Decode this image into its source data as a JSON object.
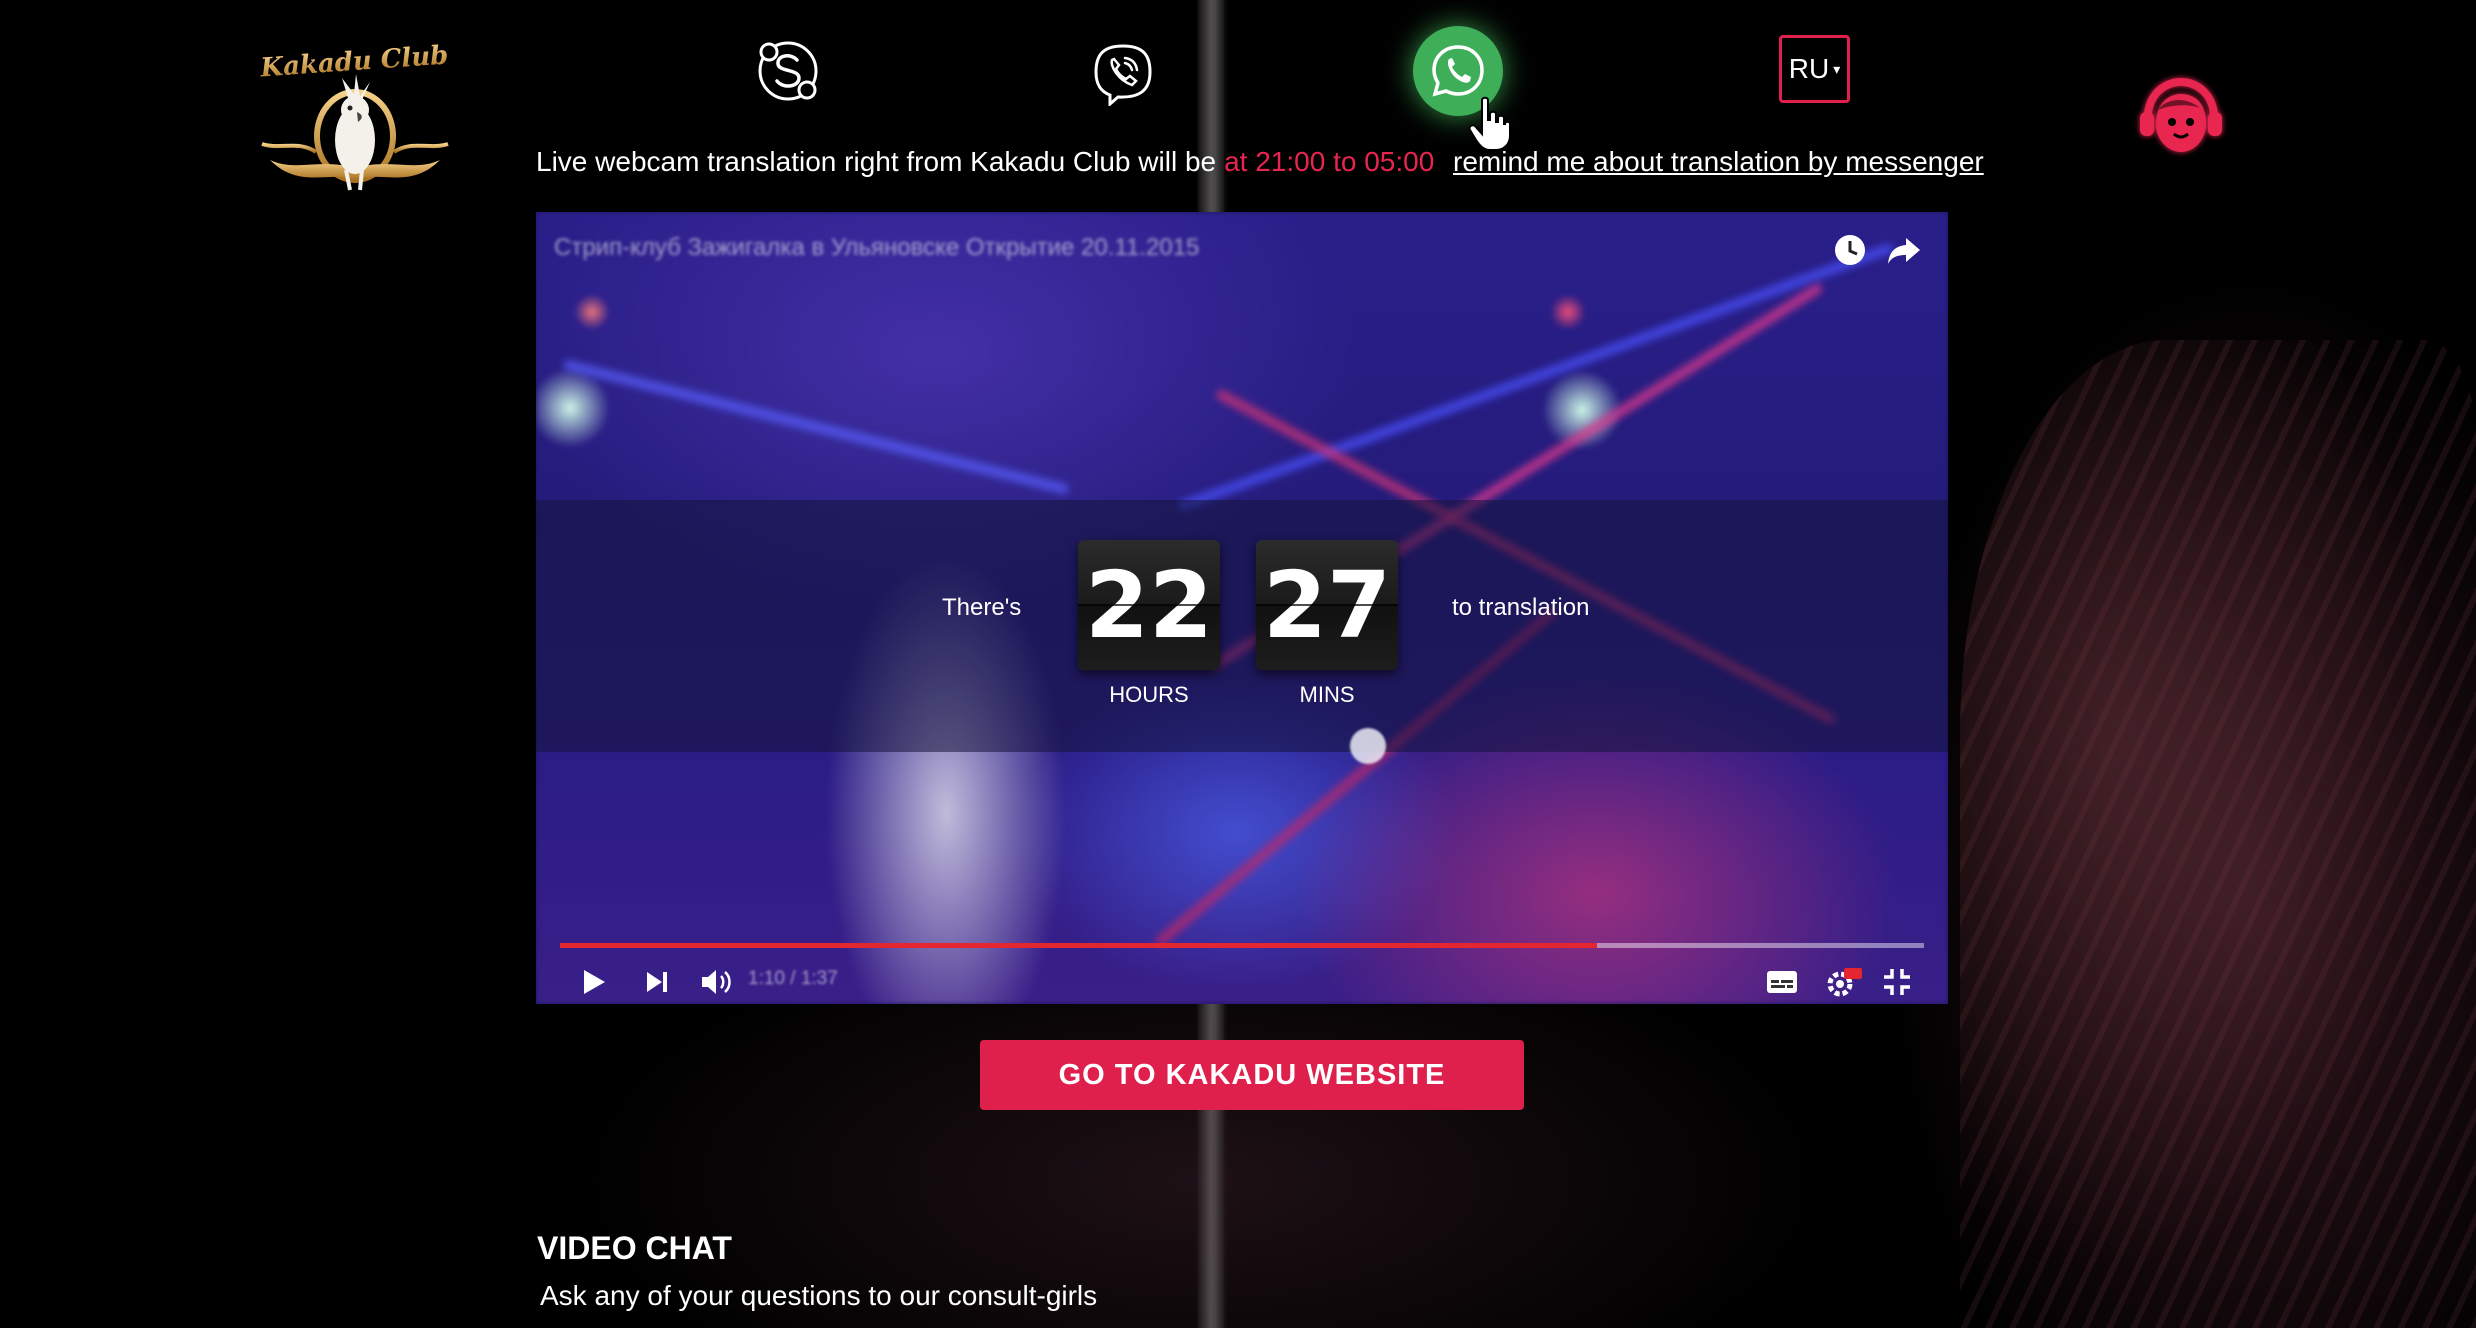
{
  "header": {
    "logo_text": "Kakadu Club",
    "lang_selector": {
      "value": "RU",
      "caret": "▾"
    },
    "messengers": [
      {
        "name": "skype-icon"
      },
      {
        "name": "viber-icon"
      },
      {
        "name": "whatsapp-icon",
        "color": "#3fae58",
        "state": "hover"
      }
    ],
    "support_icon": "headset-girl-icon"
  },
  "info": {
    "text": "Live webcam translation right from Kakadu Club will be",
    "time": "at 21:00 to 05:00",
    "remind_link": "remind me about translation by messenger"
  },
  "player": {
    "title_blurred": "Стрип-клуб Зажигалка в Ульяновске Открытие 20.11.2015",
    "countdown": {
      "prefix": "There's",
      "hours": "22",
      "hours_label": "HOURS",
      "mins": "27",
      "mins_label": "MINS",
      "suffix": "to translation"
    },
    "time_display": "1:10 / 1:37",
    "progress": 0.76,
    "progress_color": "#e3262f",
    "controls": [
      "play-icon",
      "next-icon",
      "volume-icon",
      "subtitles-icon",
      "settings-hd-icon",
      "exit-fullscreen-icon"
    ],
    "top_controls": [
      "watch-later-icon",
      "share-icon"
    ]
  },
  "cta": {
    "label": "GO TO KAKADU WEBSITE",
    "color": "#e0204c"
  },
  "video_chat": {
    "title": "VIDEO CHAT",
    "subtitle": "Ask any of your questions to our consult-girls"
  }
}
